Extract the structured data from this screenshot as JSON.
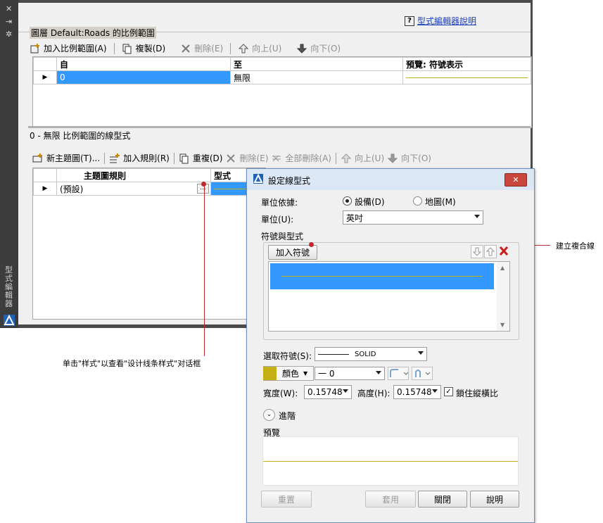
{
  "editor": {
    "help_link": "型式編輯器說明",
    "help_q": "?",
    "vertical_title": "型式編輯器",
    "upper_group_title": "圖層 Default:Roads 的比例範圍",
    "upper_toolbar": {
      "add_scale": "加入比例範圍(A)",
      "duplicate": "複製(D)",
      "delete": "刪除(E)",
      "move_up": "向上(U)",
      "move_down": "向下(O)"
    },
    "upper_grid": {
      "headers": [
        "自",
        "至",
        "預覽: 符號表示"
      ],
      "row": {
        "from": "0",
        "to": "無限"
      }
    },
    "lower_group_title": "0 - 無限 比例範圍的線型式",
    "lower_toolbar": {
      "new_theme": "新主題圖(T)...",
      "add_rule": "加入規則(R)",
      "duplicate": "重複(D)",
      "delete": "刪除(E)",
      "delete_all": "全部刪除(A)",
      "move_up": "向上(U)",
      "move_down": "向下(O)"
    },
    "lower_grid": {
      "headers": [
        "主題圖規則",
        "型式"
      ],
      "row": {
        "rule": "(預設)",
        "ellipsis": "..."
      }
    }
  },
  "dialog": {
    "title": "設定線型式",
    "units_based_on_label": "單位依據:",
    "radio_device": "設備(D)",
    "radio_map": "地圖(M)",
    "unit_label": "單位(U):",
    "unit_value": "英吋",
    "symbols_group": "符號與型式",
    "add_symbol": "加入符號",
    "selected_symbol_label": "選取符號(S):",
    "selected_symbol_value": "SOLID",
    "color_label": "顏色",
    "color_value": "#c4b014",
    "lineweight_value": "一 0",
    "width_label": "寬度(W):",
    "width_value": "0.15748",
    "height_label": "高度(H):",
    "height_value": "0.15748",
    "lock_aspect": "鎖住縱橫比",
    "advanced": "進階",
    "preview_label": "預覽",
    "buttons": {
      "reset": "重置",
      "apply": "套用",
      "close": "關閉",
      "help": "說明"
    }
  },
  "callouts": {
    "right": "建立複合線",
    "bottom": "单击\"样式\"以查看\"设计线条样式\"对话框"
  },
  "colors": {
    "selection": "#3399ff",
    "accent_line": "#c4b014",
    "callout": "#c0282d",
    "close_button": "#c9463d"
  }
}
